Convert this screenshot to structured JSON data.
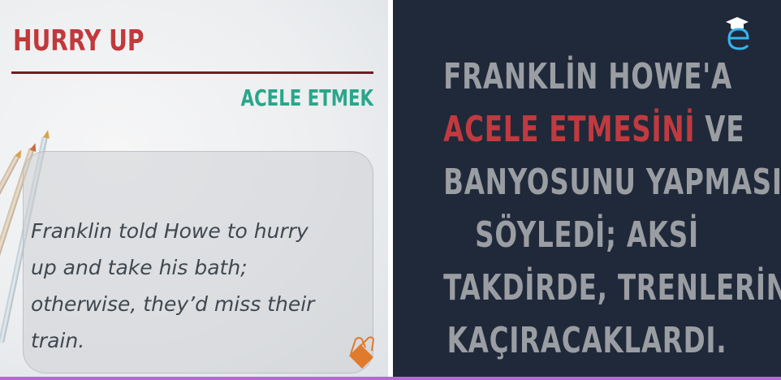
{
  "left_panel": {
    "title": "HURRY UP",
    "subtitle": "ACELE ETMEK",
    "sentence_lines": [
      "Franklin told Howe to hurry",
      "up and take his bath;",
      "otherwise, they’d miss their",
      "train."
    ]
  },
  "right_panel": {
    "line1": "FRANKLİN HOWE'A",
    "line2_highlight": "ACELE ETMESİNİ",
    "line2_rest": " VE",
    "line3": "BANYOSUNU YAPMASINI",
    "line4": "SÖYLEDİ; AKSİ",
    "line5": "TAKDİRDE, TRENLERİNİ",
    "line6": "KAÇIRACAKLARDI."
  },
  "colors": {
    "title_red": "#c0393b",
    "subtitle_green": "#2aa68a",
    "panel_dark": "#20293a",
    "highlight_red": "#c03a3f"
  },
  "icons": [
    "pencil-icon",
    "binder-clip-icon",
    "e-logo-icon"
  ]
}
